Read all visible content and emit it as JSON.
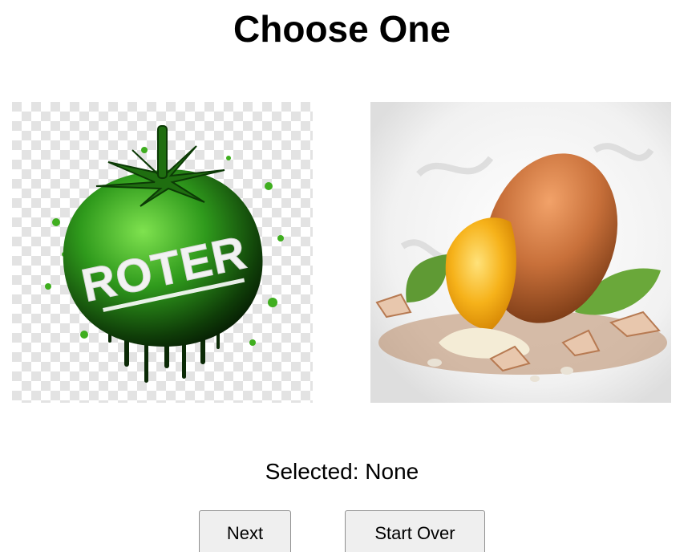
{
  "page": {
    "title": "Choose One"
  },
  "choices": [
    {
      "name": "tomato",
      "image_text": "ROTER",
      "icon": "green-tomato-illustration",
      "colors": {
        "primary": "#2f8f1c",
        "dark": "#0c2a06",
        "highlight": "#6fd84a"
      }
    },
    {
      "name": "egg",
      "icon": "cracked-egg-illustration",
      "colors": {
        "shell": "#c8703a",
        "yolk": "#f6b21a",
        "leaf": "#5f9a34"
      }
    }
  ],
  "status": {
    "selected_label": "Selected:",
    "selected_value": "None",
    "selected_text": "Selected: None"
  },
  "buttons": {
    "next_label": "Next",
    "start_over_label": "Start Over"
  }
}
